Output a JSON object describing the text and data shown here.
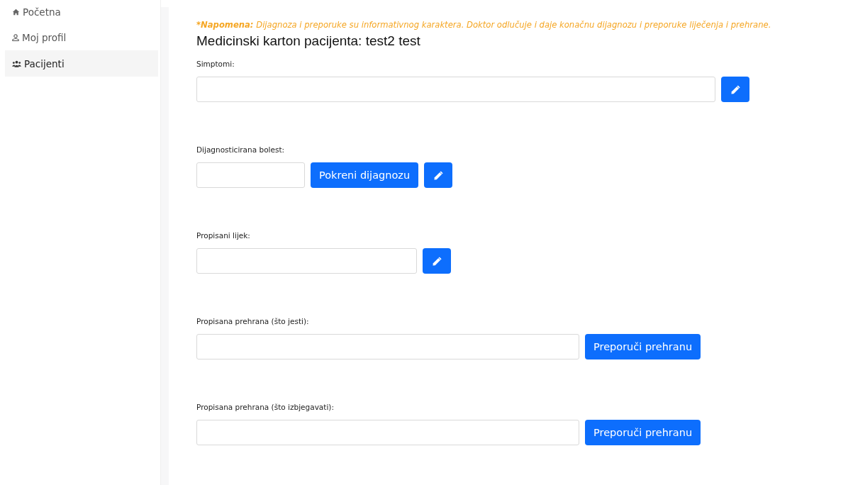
{
  "sidebar": {
    "items": [
      {
        "kind": "home",
        "label": "Početna",
        "selected": false
      },
      {
        "kind": "user",
        "label": "Moj profil",
        "selected": false
      },
      {
        "kind": "users",
        "label": "Pacijenti",
        "selected": true
      }
    ]
  },
  "note": {
    "lead": "*Napomena:",
    "text": "Dijagnoza i preporuke su informativnog karaktera. Doktor odlučuje i daje konačnu dijagnozu i preporuke liječenja i prehrane."
  },
  "title": "Medicinski karton pacijenta: test2 test",
  "sections": [
    {
      "label": "Simptomi:",
      "buttons": [
        {
          "kind": "edit"
        }
      ]
    },
    {
      "label": "Dijagnosticirana bolest:",
      "buttons": [
        {
          "kind": "text",
          "label": "Pokreni dijagnozu"
        },
        {
          "kind": "edit"
        }
      ]
    },
    {
      "label": "Propisani lijek:",
      "buttons": [
        {
          "kind": "edit"
        }
      ]
    },
    {
      "label": "Propisana prehrana (što jesti):",
      "buttons": [
        {
          "kind": "text",
          "label": "Preporuči prehranu"
        }
      ]
    },
    {
      "label": "Propisana prehrana (što izbjegavati):",
      "buttons": [
        {
          "kind": "text",
          "label": "Preporuči prehranu"
        }
      ]
    }
  ]
}
